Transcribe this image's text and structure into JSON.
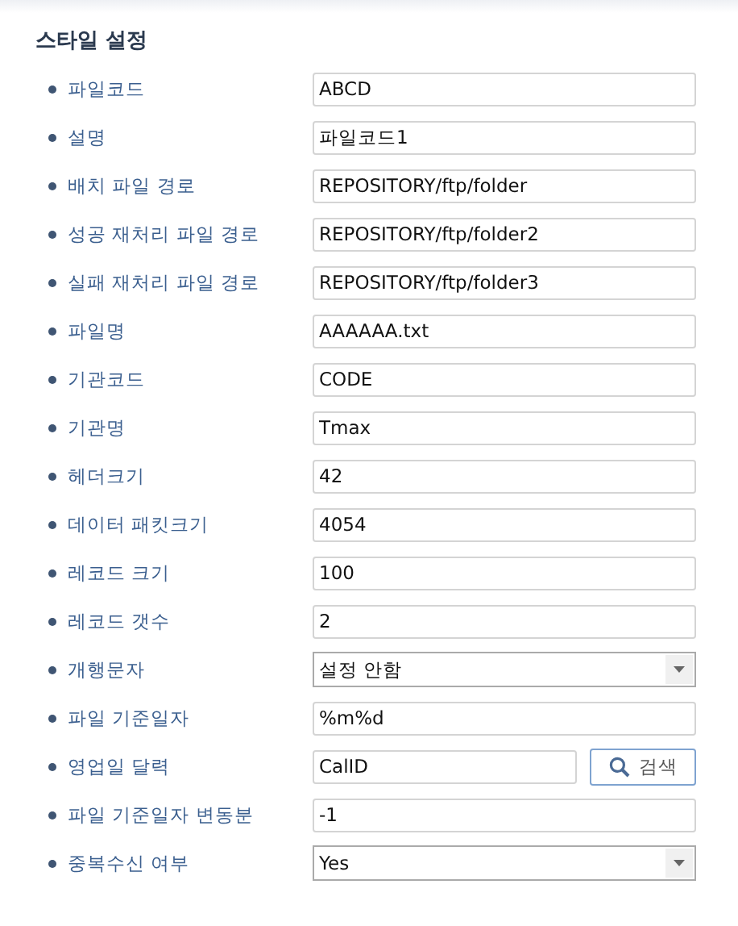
{
  "title": "스타일 설정",
  "fields": [
    {
      "label": "파일코드",
      "kind": "text",
      "value": "ABCD"
    },
    {
      "label": "설명",
      "kind": "text",
      "value": "파일코드1"
    },
    {
      "label": "배치 파일 경로",
      "kind": "text",
      "value": "REPOSITORY/ftp/folder"
    },
    {
      "label": "성공 재처리 파일 경로",
      "kind": "text",
      "value": "REPOSITORY/ftp/folder2"
    },
    {
      "label": "실패 재처리 파일 경로",
      "kind": "text",
      "value": "REPOSITORY/ftp/folder3"
    },
    {
      "label": "파일명",
      "kind": "text",
      "value": "AAAAAA.txt"
    },
    {
      "label": "기관코드",
      "kind": "text",
      "value": "CODE"
    },
    {
      "label": "기관명",
      "kind": "text",
      "value": "Tmax"
    },
    {
      "label": "헤더크기",
      "kind": "text",
      "value": "42"
    },
    {
      "label": "데이터 패킷크기",
      "kind": "text",
      "value": "4054"
    },
    {
      "label": "레코드 크기",
      "kind": "text",
      "value": "100"
    },
    {
      "label": "레코드 갯수",
      "kind": "text",
      "value": "2"
    },
    {
      "label": "개행문자",
      "kind": "select",
      "value": "설정 안함"
    },
    {
      "label": "파일 기준일자",
      "kind": "text",
      "value": "%m%d"
    },
    {
      "label": "영업일 달력",
      "kind": "search",
      "value": "CalID",
      "button": "검색"
    },
    {
      "label": "파일 기준일자 변동분",
      "kind": "text",
      "value": "-1"
    },
    {
      "label": "중복수신 여부",
      "kind": "select",
      "value": "Yes"
    }
  ]
}
